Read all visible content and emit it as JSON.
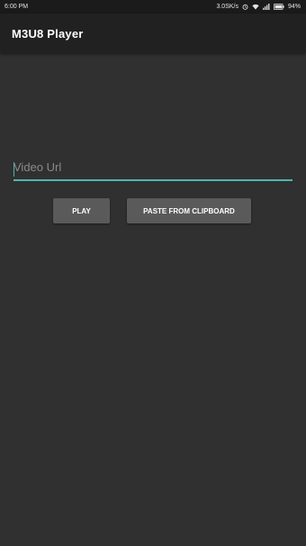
{
  "status_bar": {
    "time": "6:00 PM",
    "network_speed": "3.0SK/s",
    "battery": "94%",
    "icons": [
      "alarm-icon",
      "wifi-icon",
      "signal-icon",
      "battery-icon"
    ]
  },
  "app_bar": {
    "title": "M3U8 Player"
  },
  "url_input": {
    "placeholder": "Video Url",
    "value": ""
  },
  "buttons": {
    "play_label": "PLAY",
    "paste_label": "PASTE FROM CLIPBOARD"
  },
  "colors": {
    "background": "#303030",
    "app_bar": "#212121",
    "status_bar": "#1b1b1b",
    "accent": "#4db6ac",
    "button": "#5a5a5a"
  }
}
